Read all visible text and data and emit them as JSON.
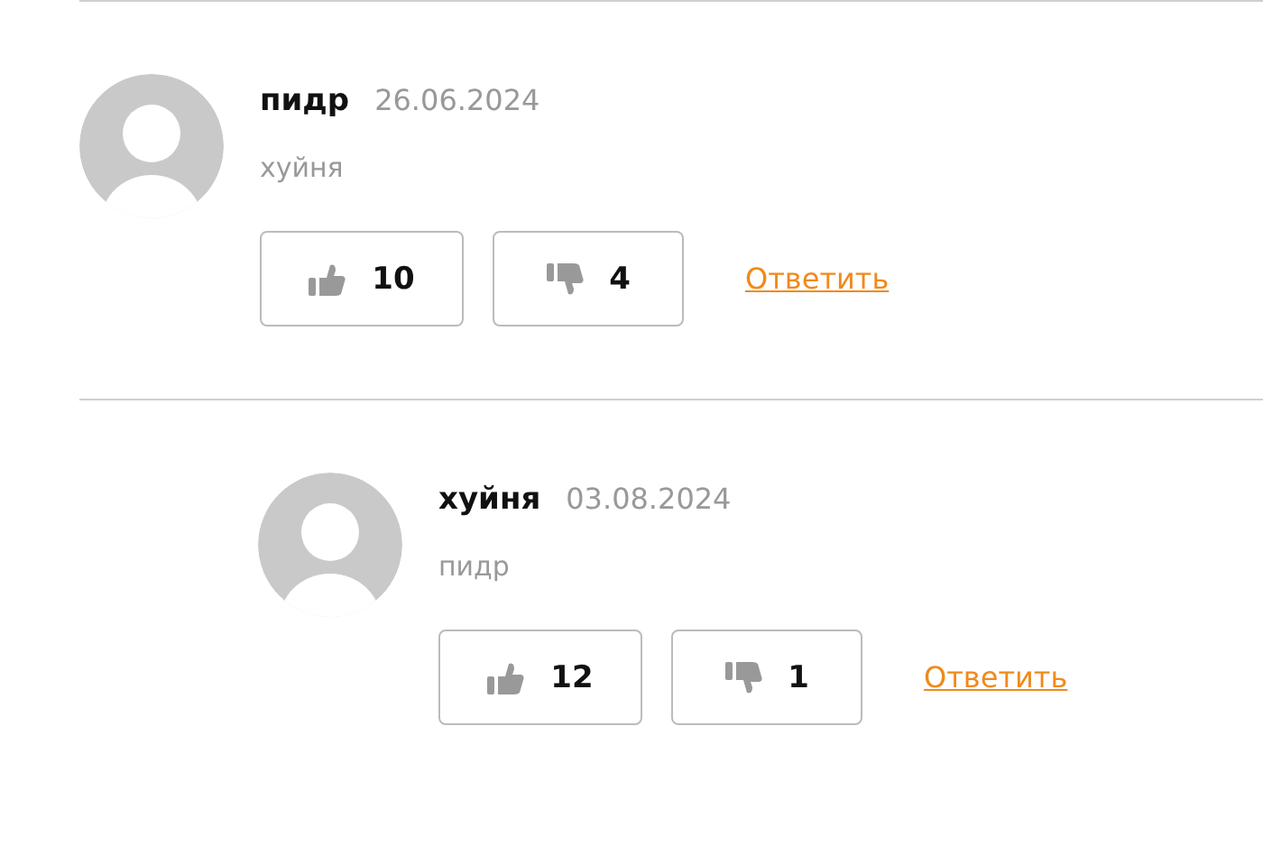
{
  "comments": [
    {
      "author": "пидр",
      "date": "26.06.2024",
      "text": "хуйня",
      "likes": "10",
      "dislikes": "4",
      "reply": "Ответить",
      "children": [
        {
          "author": "хуйня",
          "date": "03.08.2024",
          "text": "пидр",
          "likes": "12",
          "dislikes": "1",
          "reply": "Ответить"
        }
      ]
    }
  ]
}
